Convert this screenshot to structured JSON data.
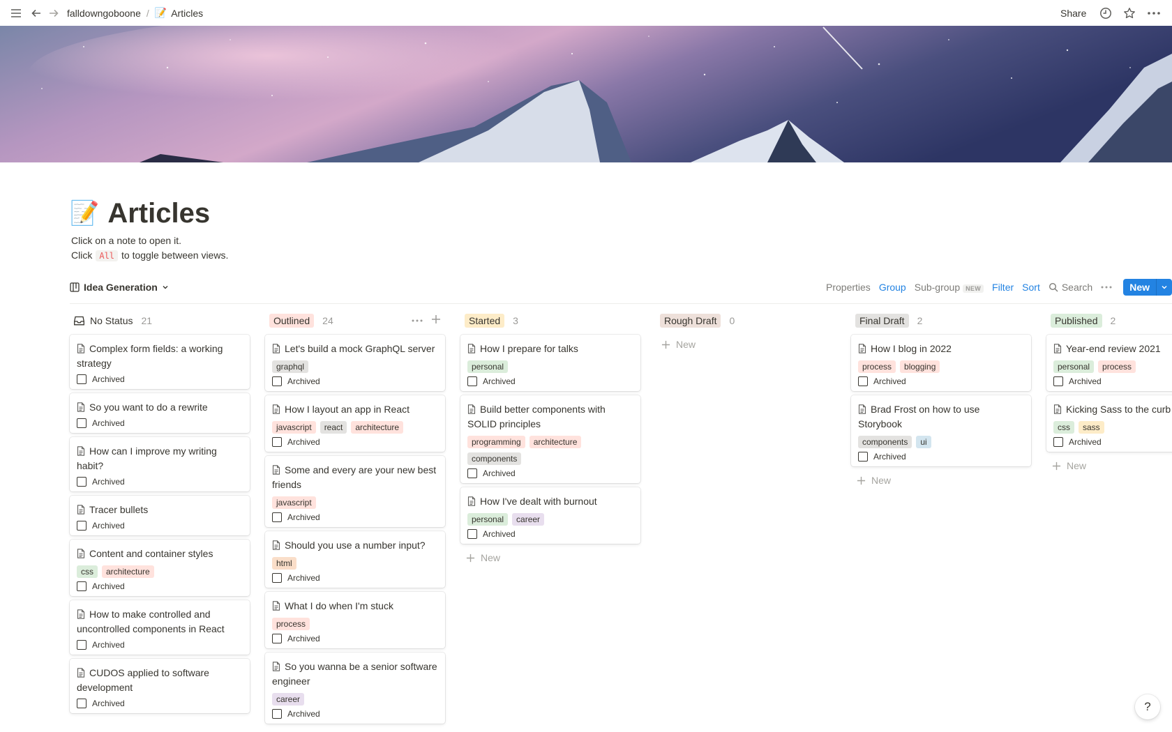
{
  "topbar": {
    "workspace": "falldowngoboone",
    "separator": "/",
    "page_emoji": "📝",
    "page_name": "Articles",
    "share": "Share"
  },
  "page": {
    "emoji": "📝",
    "title": "Articles",
    "desc_line1": "Click on a note to open it.",
    "desc_line2_before": "Click",
    "desc_line2_code": "All",
    "desc_line2_after": "to toggle between views."
  },
  "view": {
    "name": "Idea Generation",
    "properties": "Properties",
    "group": "Group",
    "subgroup": "Sub-group",
    "subgroup_badge": "NEW",
    "filter": "Filter",
    "sort": "Sort",
    "search": "Search",
    "new_button": "New"
  },
  "colors": {
    "accent": "#2383e2",
    "tag_green": "#dbeddb",
    "tag_red": "#ffe2dd",
    "tag_gray": "#e3e2e0",
    "tag_orange": "#fadec9",
    "tag_yellow": "#fdecc8",
    "tag_purple": "#e8deee",
    "tag_blue": "#d3e5ef",
    "tag_brown": "#eee0da"
  },
  "board": {
    "checkbox_label": "Archived",
    "new_label": "New",
    "columns": [
      {
        "name": "No Status",
        "count": "21",
        "cards": [
          {
            "title": "Complex form fields: a working strategy",
            "tags": []
          },
          {
            "title": "So you want to do a rewrite",
            "tags": []
          },
          {
            "title": "How can I improve my writing habit?",
            "tags": []
          },
          {
            "title": "Tracer bullets",
            "tags": []
          },
          {
            "title": "Content and container styles",
            "tags": [
              "css",
              "architecture"
            ]
          },
          {
            "title": "How to make controlled and uncontrolled components in React",
            "tags": []
          },
          {
            "title": "CUDOS applied to software development",
            "tags": []
          }
        ]
      },
      {
        "name": "Outlined",
        "count": "24",
        "cards": [
          {
            "title": "Let's build a mock GraphQL server",
            "tags": [
              "graphql"
            ]
          },
          {
            "title": "How I layout an app in React",
            "tags": [
              "javascript",
              "react",
              "architecture"
            ]
          },
          {
            "title": "Some and every are your new best friends",
            "tags": [
              "javascript"
            ]
          },
          {
            "title": "Should you use a number input?",
            "tags": [
              "html"
            ]
          },
          {
            "title": "What I do when I'm stuck",
            "tags": [
              "process"
            ]
          },
          {
            "title": "So you wanna be a senior software engineer",
            "tags": [
              "career"
            ]
          }
        ]
      },
      {
        "name": "Started",
        "count": "3",
        "cards": [
          {
            "title": "How I prepare for talks",
            "tags": [
              "personal"
            ]
          },
          {
            "title": "Build better components with SOLID principles",
            "tags": [
              "programming",
              "architecture",
              "components"
            ]
          },
          {
            "title": "How I've dealt with burnout",
            "tags": [
              "personal",
              "career"
            ]
          }
        ]
      },
      {
        "name": "Rough Draft",
        "count": "0",
        "cards": []
      },
      {
        "name": "Final Draft",
        "count": "2",
        "cards": [
          {
            "title": "How I blog in 2022",
            "tags": [
              "process",
              "blogging"
            ]
          },
          {
            "title": "Brad Frost on how to use Storybook",
            "tags": [
              "components",
              "ui"
            ]
          }
        ]
      },
      {
        "name": "Published",
        "count": "2",
        "cards": [
          {
            "title": "Year-end review 2021",
            "tags": [
              "personal",
              "process"
            ]
          },
          {
            "title": "Kicking Sass to the curb",
            "tags": [
              "css",
              "sass"
            ]
          }
        ]
      }
    ]
  },
  "help": "?"
}
